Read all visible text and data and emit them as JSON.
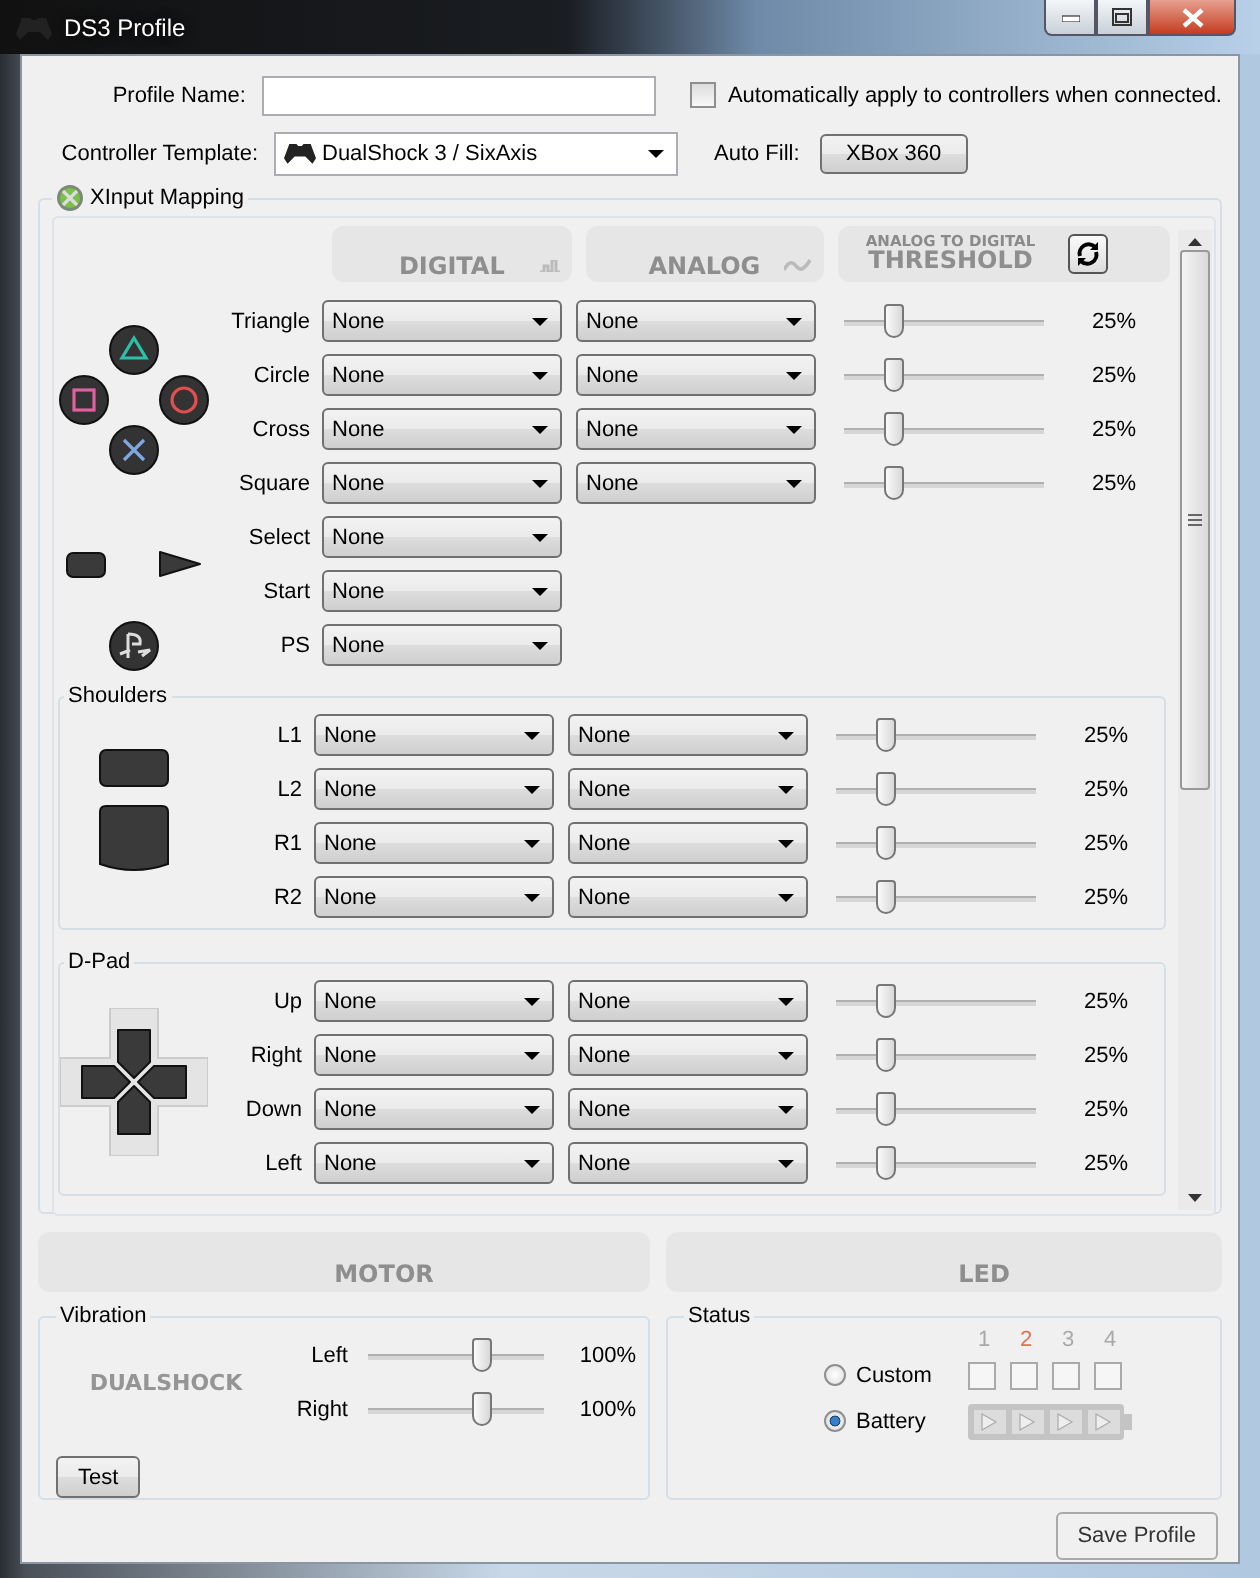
{
  "window": {
    "title": "DS3 Profile"
  },
  "profile_name": {
    "label": "Profile Name:"
  },
  "auto_apply": {
    "label": "Automatically apply to controllers when connected.",
    "checked": false
  },
  "controller_template": {
    "label": "Controller Template:",
    "value": "DualShock 3 / SixAxis"
  },
  "auto_fill": {
    "label": "Auto Fill:",
    "button": "XBox 360"
  },
  "xinput_mapping": {
    "title": "XInput Mapping",
    "headers": {
      "digital": "DIGITAL",
      "analog": "ANALOG",
      "threshold_caption": "ANALOG TO DIGITAL",
      "threshold": "THRESHOLD"
    },
    "sections": [
      {
        "kind": "face",
        "rows": [
          {
            "label": "Triangle",
            "digital": "None",
            "analog": "None",
            "level": 0.25,
            "reading": "25%"
          },
          {
            "label": "Circle",
            "digital": "None",
            "analog": "None",
            "level": 0.25,
            "reading": "25%"
          },
          {
            "label": "Cross",
            "digital": "None",
            "analog": "None",
            "level": 0.25,
            "reading": "25%"
          },
          {
            "label": "Square",
            "digital": "None",
            "analog": "None",
            "level": 0.25,
            "reading": "25%"
          },
          {
            "label": "Select",
            "digital": "None"
          },
          {
            "label": "Start",
            "digital": "None"
          },
          {
            "label": "PS",
            "digital": "None"
          }
        ]
      },
      {
        "kind": "shoulders",
        "title": "Shoulders",
        "rows": [
          {
            "label": "L1",
            "digital": "None",
            "analog": "None",
            "level": 0.25,
            "reading": "25%"
          },
          {
            "label": "L2",
            "digital": "None",
            "analog": "None",
            "level": 0.25,
            "reading": "25%"
          },
          {
            "label": "R1",
            "digital": "None",
            "analog": "None",
            "level": 0.25,
            "reading": "25%"
          },
          {
            "label": "R2",
            "digital": "None",
            "analog": "None",
            "level": 0.25,
            "reading": "25%"
          }
        ]
      },
      {
        "kind": "dpad",
        "title": "D-Pad",
        "rows": [
          {
            "label": "Up",
            "digital": "None",
            "analog": "None",
            "level": 0.25,
            "reading": "25%"
          },
          {
            "label": "Right",
            "digital": "None",
            "analog": "None",
            "level": 0.25,
            "reading": "25%"
          },
          {
            "label": "Down",
            "digital": "None",
            "analog": "None",
            "level": 0.25,
            "reading": "25%"
          },
          {
            "label": "Left",
            "digital": "None",
            "analog": "None",
            "level": 0.25,
            "reading": "25%"
          }
        ]
      }
    ]
  },
  "motor": {
    "header": "MOTOR",
    "group": "Vibration",
    "logo": "DUALSHOCK",
    "sliders": [
      {
        "label": "Left",
        "level": 0.65,
        "reading": "100%"
      },
      {
        "label": "Right",
        "level": 0.65,
        "reading": "100%"
      }
    ],
    "test_button": "Test"
  },
  "led": {
    "header": "LED",
    "group": "Status",
    "modes": [
      {
        "label": "Custom",
        "selected": false
      },
      {
        "label": "Battery",
        "selected": true
      }
    ],
    "leds": [
      {
        "label": "1",
        "lit": false,
        "checked": false
      },
      {
        "label": "2",
        "lit": true,
        "checked": false
      },
      {
        "label": "3",
        "lit": false,
        "checked": false
      },
      {
        "label": "4",
        "lit": false,
        "checked": false
      }
    ]
  },
  "save_button": "Save Profile"
}
